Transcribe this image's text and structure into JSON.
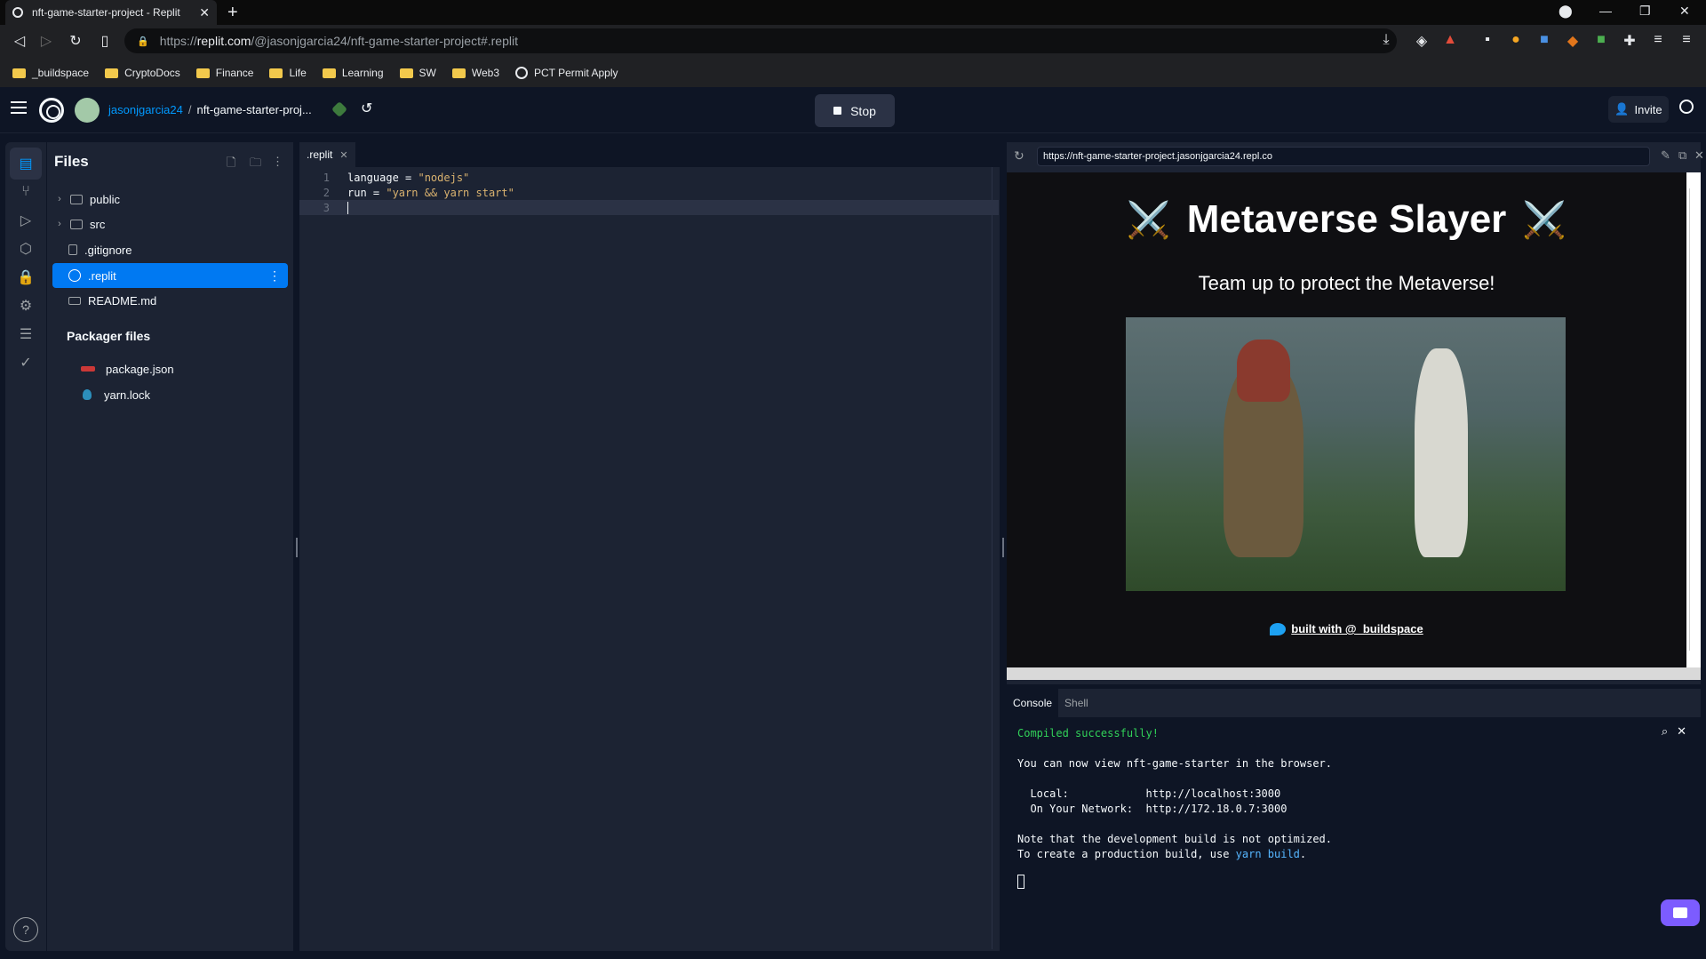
{
  "browser": {
    "tab_title": "nft-game-starter-project - Replit",
    "url_prefix": "https://",
    "url_host": "replit.com",
    "url_path": "/@jasonjgarcia24/nft-game-starter-project#.replit",
    "bookmarks": [
      "_buildspace",
      "CryptoDocs",
      "Finance",
      "Life",
      "Learning",
      "SW",
      "Web3",
      "PCT Permit Apply"
    ]
  },
  "header": {
    "username": "jasonjgarcia24",
    "separator": "/",
    "project": "nft-game-starter-proj...",
    "stop_label": "Stop",
    "invite_label": "Invite"
  },
  "files": {
    "title": "Files",
    "items": [
      {
        "label": "public",
        "type": "folder"
      },
      {
        "label": "src",
        "type": "folder"
      },
      {
        "label": ".gitignore",
        "type": "file"
      },
      {
        "label": ".replit",
        "type": "replit",
        "selected": true
      },
      {
        "label": "README.md",
        "type": "markdown"
      }
    ],
    "packager_title": "Packager files",
    "packager_items": [
      "package.json",
      "yarn.lock"
    ]
  },
  "editor": {
    "tab_label": ".replit",
    "lines": [
      {
        "n": "1",
        "key": "language = ",
        "val": "\"nodejs\""
      },
      {
        "n": "2",
        "key": "run = ",
        "val": "\"yarn && yarn start\""
      },
      {
        "n": "3",
        "key": "",
        "val": ""
      }
    ]
  },
  "webview": {
    "url": "https://nft-game-starter-project.jasonjgarcia24.repl.co",
    "heading": "Metaverse Slayer",
    "heading_icon": "⚔️",
    "subtitle": "Team up to protect the Metaverse!",
    "footer_link": "built with @_buildspace"
  },
  "console": {
    "tabs": [
      "Console",
      "Shell"
    ],
    "compiled": "Compiled successfully!",
    "line1": "You can now view nft-game-starter in the browser.",
    "local_label": "  Local:            ",
    "local_url": "http://localhost:3000",
    "network_label": "  On Your Network:  ",
    "network_url": "http://172.18.0.7:3000",
    "note1": "Note that the development build is not optimized.",
    "note2_prefix": "To create a production build, use ",
    "note2_cmd": "yarn build",
    "note2_suffix": "."
  }
}
